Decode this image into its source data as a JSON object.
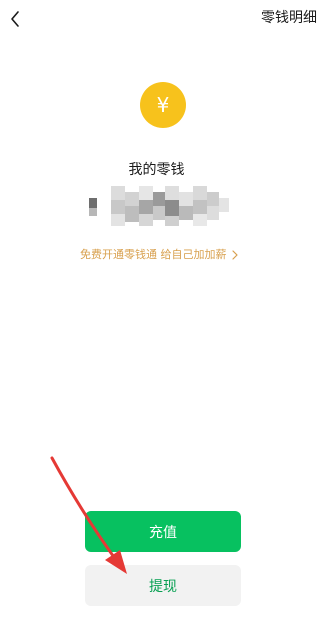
{
  "header": {
    "back_icon": "chevron-left-icon",
    "details_label": "零钱明细"
  },
  "balance": {
    "coin_icon": "yuan-coin-icon",
    "coin_symbol": "¥",
    "title": "我的零钱"
  },
  "promo": {
    "text": "免费开通零钱通 给自己加加薪",
    "chevron_icon": "chevron-right-icon"
  },
  "actions": {
    "recharge_label": "充值",
    "withdraw_label": "提现"
  },
  "colors": {
    "accent_green": "#07c160",
    "withdraw_text": "#07a052",
    "promo_gold": "#d8a04e",
    "coin_yellow": "#f7c21c",
    "annotation_red": "#e53935"
  }
}
